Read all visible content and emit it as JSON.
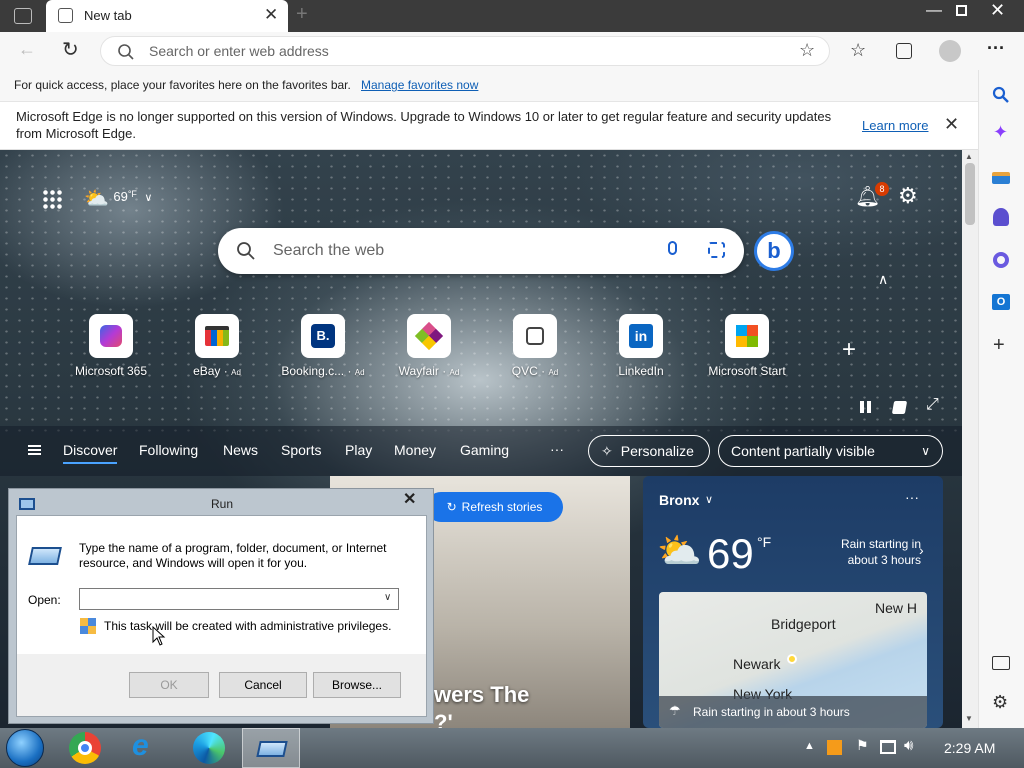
{
  "browser": {
    "tab_title": "New tab",
    "address_placeholder": "Search or enter web address",
    "favorites_message": "For quick access, place your favorites here on the favorites bar.",
    "favorites_link": "Manage favorites now",
    "infobar_message": "Microsoft Edge is no longer supported on this version of Windows. Upgrade to Windows 10 or later to get regular feature and security updates from Microsoft Edge.",
    "infobar_link": "Learn more"
  },
  "newtab": {
    "weather_temp": "69",
    "weather_unit": "°F",
    "notifications_count": "8",
    "search_placeholder": "Search the web",
    "quicklinks": [
      {
        "label": "Microsoft 365",
        "ad": ""
      },
      {
        "label": "eBay",
        "ad": "Ad"
      },
      {
        "label": "Booking.c...",
        "ad": "Ad"
      },
      {
        "label": "Wayfair",
        "ad": "Ad"
      },
      {
        "label": "QVC",
        "ad": "Ad"
      },
      {
        "label": "LinkedIn",
        "ad": ""
      },
      {
        "label": "Microsoft Start",
        "ad": ""
      }
    ],
    "nav_tabs": [
      "Discover",
      "Following",
      "News",
      "Sports",
      "Play",
      "Money",
      "Gaming"
    ],
    "more_label": "···",
    "personalize_label": "Personalize",
    "content_visibility": "Content partially visible",
    "refresh_label": "Refresh stories",
    "headline_fragment": "wers The",
    "headline_fragment2": "?'"
  },
  "weather_card": {
    "location": "Bronx",
    "temp": "69",
    "unit": "°F",
    "forecast": "Rain starting in about 3 hours",
    "map_labels": [
      "New H",
      "Bridgeport",
      "Newark",
      "New York"
    ],
    "footer": "Rain starting in about 3 hours"
  },
  "run_dialog": {
    "title": "Run",
    "description": "Type the name of a program, folder, document, or Internet resource, and Windows will open it for you.",
    "open_label": "Open:",
    "open_value": "",
    "admin_note": "This task will be created with administrative privileges.",
    "ok_label": "OK",
    "cancel_label": "Cancel",
    "browse_label": "Browse..."
  },
  "taskbar": {
    "clock": "2:29 AM"
  },
  "colors": {
    "accent": "#1a73e8",
    "link": "#0f5fb5",
    "notif_badge": "#d83b01"
  }
}
